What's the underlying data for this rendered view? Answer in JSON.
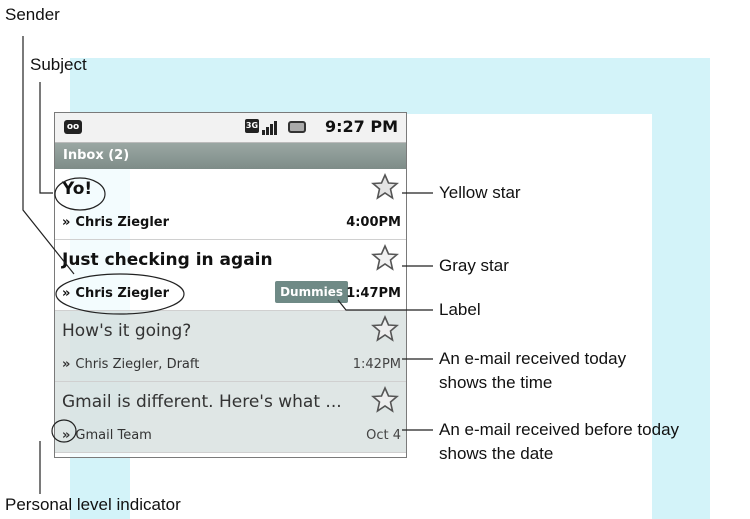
{
  "callouts": {
    "sender": "Sender",
    "subject": "Subject",
    "yellow_star": "Yellow star",
    "gray_star": "Gray star",
    "label": "Label",
    "received_today_1": "An e-mail received today",
    "received_today_2": "shows the time",
    "received_before_1": "An e-mail received before today",
    "received_before_2": "shows the date",
    "personal_level": "Personal level indicator"
  },
  "status_bar": {
    "time": "9:27 PM",
    "network_badge": "3G",
    "voicemail_glyph": "oo",
    "icons": [
      "voicemail-icon",
      "3g-icon",
      "signal-icon",
      "battery-icon"
    ]
  },
  "inbox": {
    "title": "Inbox (2)"
  },
  "messages": [
    {
      "subject": "Yo!",
      "sender": "Chris Ziegler",
      "time": "4:00PM",
      "unread": true,
      "star": "yellow",
      "chevron": "»"
    },
    {
      "subject": "Just checking in again",
      "sender": "Chris Ziegler",
      "time": "1:47PM",
      "unread": true,
      "star": "gray",
      "label": "Dummies",
      "chevron": "»"
    },
    {
      "subject": "How's it going?",
      "sender": "Chris Ziegler, Draft",
      "time": "1:42PM",
      "unread": false,
      "star": "gray",
      "chevron": "»"
    },
    {
      "subject": "Gmail is different. Here's what ...",
      "sender": "Gmail Team",
      "time": "Oct 4",
      "unread": false,
      "star": "gray",
      "chevron": "»"
    }
  ],
  "colors": {
    "watermark": "#d3f3f9",
    "inbox_bar": "#8a9894",
    "label_chip": "#6f8a86",
    "read_row": "#c4d2d0"
  }
}
